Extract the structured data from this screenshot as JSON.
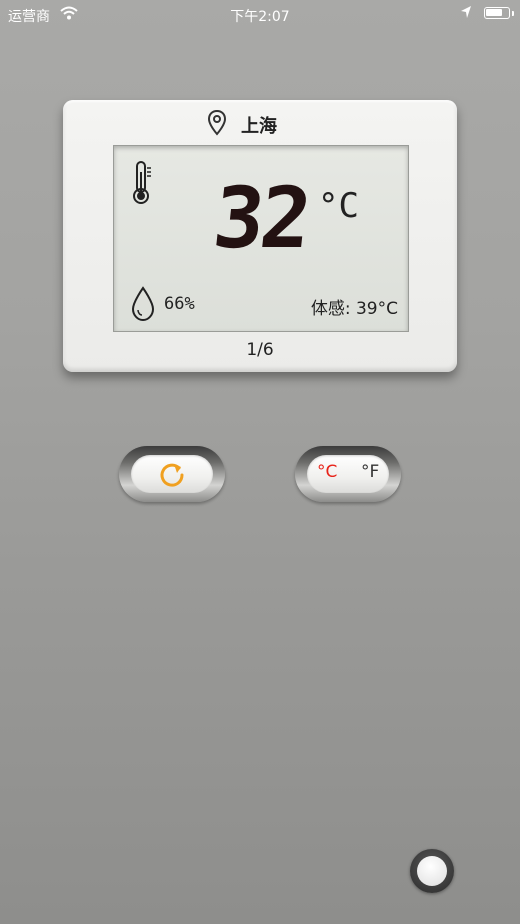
{
  "status_bar": {
    "carrier": "运营商",
    "time": "下午2:07",
    "battery_level": 0.75
  },
  "weather_card": {
    "city": "上海",
    "temperature": "32",
    "temperature_unit": "°C",
    "humidity": "66%",
    "feels_like": "体感: 39°C",
    "page_indicator": "1/6"
  },
  "unit_toggle": {
    "celsius_label": "°C",
    "fahrenheit_label": "°F",
    "selected": "celsius"
  },
  "colors": {
    "accent_orange": "#f0a020",
    "celsius_active": "#e8241a",
    "lcd_digits": "#231212"
  },
  "icons": {
    "location": "map-pin-icon",
    "thermometer": "thermometer-icon",
    "humidity": "water-drop-icon",
    "refresh": "refresh-icon"
  }
}
